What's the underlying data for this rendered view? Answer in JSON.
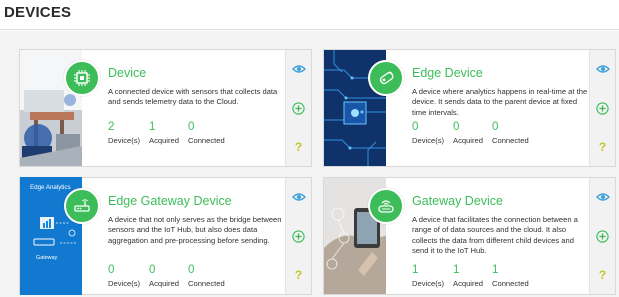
{
  "page": {
    "title": "DEVICES"
  },
  "colors": {
    "accent": "#3dbd5a",
    "eye": "#3aa0d8",
    "help": "#c7c72a"
  },
  "cards": [
    {
      "title": "Device",
      "icon": "chip-icon",
      "description": "A connected device with sensors that collects data and sends telemetry data to the Cloud.",
      "stats": [
        {
          "value": "2",
          "label": "Device(s)"
        },
        {
          "value": "1",
          "label": "Acquired"
        },
        {
          "value": "0",
          "label": "Connected"
        }
      ]
    },
    {
      "title": "Edge Device",
      "icon": "edge-device-icon",
      "description": "A device where analytics happens in real-time at the device. It sends data to the parent device at fixed time intervals.",
      "stats": [
        {
          "value": "0",
          "label": "Device(s)"
        },
        {
          "value": "0",
          "label": "Acquired"
        },
        {
          "value": "0",
          "label": "Connected"
        }
      ]
    },
    {
      "title": "Edge Gateway Device",
      "icon": "router-icon",
      "thumb_text": "Edge Analytics",
      "thumb_sub": "Gateway",
      "description": "A device that not only serves as the bridge between sensors and the IoT Hub, but also does data aggregation and pre-processing before sending.",
      "stats": [
        {
          "value": "0",
          "label": "Device(s)"
        },
        {
          "value": "0",
          "label": "Acquired"
        },
        {
          "value": "0",
          "label": "Connected"
        }
      ]
    },
    {
      "title": "Gateway Device",
      "icon": "gateway-icon",
      "description": "A device that facilitates the connection between a range of of data sources and the cloud. It also collects the data from different child devices and send it to the IoT Hub.",
      "stats": [
        {
          "value": "1",
          "label": "Device(s)"
        },
        {
          "value": "1",
          "label": "Acquired"
        },
        {
          "value": "1",
          "label": "Connected"
        }
      ]
    }
  ],
  "actions": {
    "help_label": "?"
  }
}
